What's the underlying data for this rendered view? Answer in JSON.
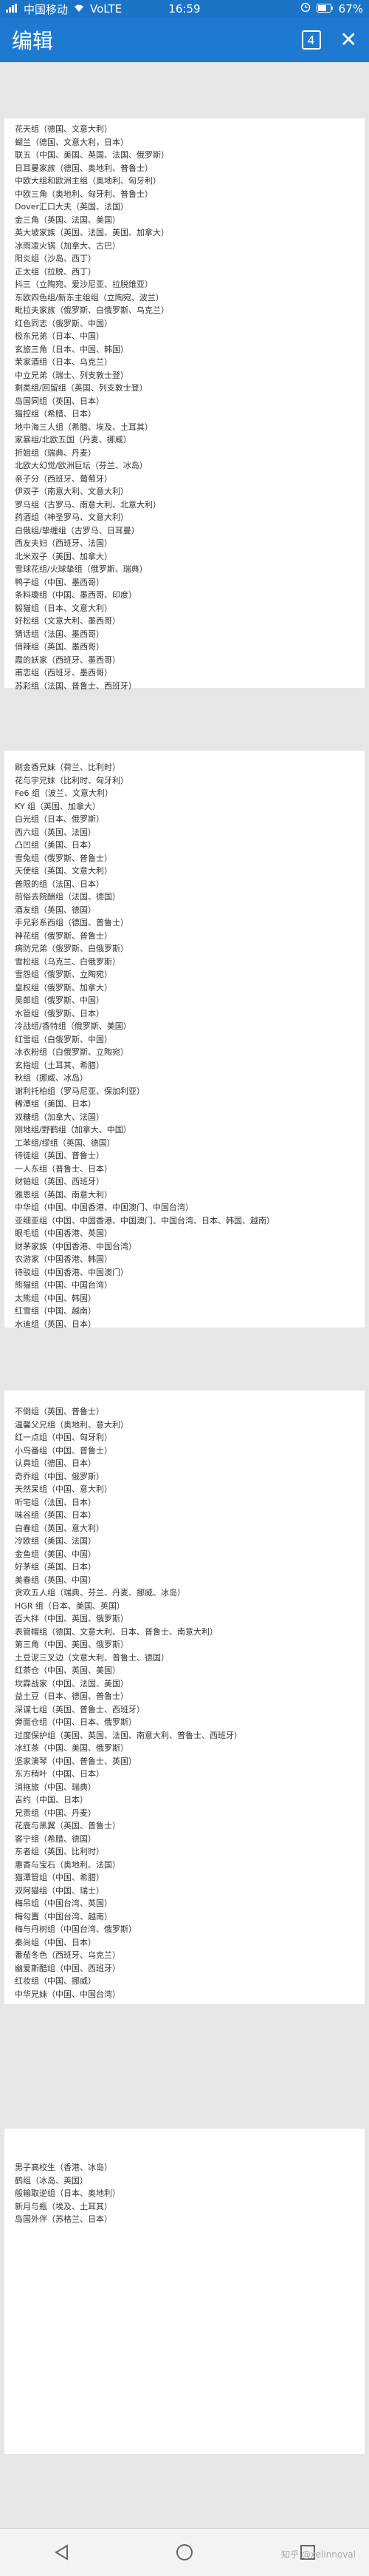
{
  "status_bar": {
    "carrier": "中国移动",
    "network": "VoLTE",
    "time": "16:59",
    "battery": "67%"
  },
  "toolbar": {
    "title": "编辑",
    "tab_count": "4"
  },
  "pages": [
    [
      "花天组（德国、文意大利）",
      "蝴兰（德国、文意大利，日本）",
      "联五（中国、美国、英国、法国、俄罗斯）",
      "日耳曼家族（德国、奥地利、普鲁士）",
      "中欧大组和欧洲主组（奥地利、匈牙利）",
      "中欧三角（奥地利、匈牙利、普鲁士）",
      "Dover汇口大夫（英国、法国）",
      "金三角（英国、法国、美国）",
      "英大坡家族（英国、法国、美国、加拿大）",
      "冰雨凌火锅（加拿大、古巴）",
      "阳炎组（沙岛、西丁）",
      "正太组（拉脱、西丁）",
      "抖三（立陶宛、爱沙尼亚、拉脱维亚）",
      "东欧四色组/新东主组组（立陶宛、波兰）",
      "毗拉夫家族（俄罗斯、白俄罗斯、乌克兰）",
      "红色同志（俄罗斯、中国）",
      "极东兄弟（日本、中国）",
      "玄旅三角（日本、中国、韩国）",
      "茉家酒组（日本、乌克兰）",
      "中立兄弟（瑞士、列支敦士登）",
      "剩类组/回留组（英国、列支敦士登）",
      "岛国同组（英国、日本）",
      "猫控组（希腊、日本）",
      "地中海三人组（希腊、埃及、土耳其）",
      "家暴组/北欧五国（丹麦、挪威）",
      "折姐组（瑞典、丹麦）",
      "北欧大幻觉/欧洲巨坛（芬兰、冰岛）",
      "亲子分（西班牙、葡萄牙）",
      "伊双子（南意大利、文意大利）",
      "罗马组（古罗马、南意大利、北意大利）",
      "药酒组（神圣罗马、文意大利）",
      "白俄组/挚缠组（古罗马、日耳曼）",
      "西友夫妇（西班牙、法国）",
      "北米双子（美国、加拿大）",
      "雪球花组/火球挚组（俄罗斯、瑞典）",
      "鸭子组（中国、墨西哥）",
      "条料瓊组（中国、墨西哥、印度）",
      "毅猫组（日本、文意大利）",
      "好松组（文意大利、墨西哥）",
      "猜话组（法国、墨西哥）",
      "俏辣组（英国、墨西哥）",
      "霞的妖家（西班牙、墨西哥）",
      "甫恋组（西班牙、墨西哥）",
      "苏彩组（法国、普鲁士、西班牙）"
    ],
    [
      "刷金香兄妹（荷兰、比利时）",
      "花与宇兄妹（比利时、匈牙利）",
      "Fe6 组（波兰、文意大利）",
      "KY 组（英国、加拿大）",
      "白光组（日本、俄罗斯）",
      "西六组（英国、法国）",
      "凸凹组（美国、日本）",
      "雪兔组（俄罗斯、普鲁士）",
      "天使组（英国、文意大利）",
      "普限的组（法国、日本）",
      "前俗去院酬组（法国、德国）",
      "酒友组（英国、德国）",
      "手兄彩系西组（德国、普鲁士）",
      "神花组（俄罗斯、普鲁士）",
      "病防兄弟（俄罗斯、白俄罗斯）",
      "雪松组（乌克兰、白俄罗斯）",
      "雪怨组（俄罗斯、立陶宛）",
      "皇权组（俄罗斯、加拿大）",
      "吴郎组（俄罗斯、中国）",
      "水管组（俄罗斯、日本）",
      "冷战组/香特组（俄罗斯、美国）",
      "红雪组（白俄罗斯、中国）",
      "冰衣粉组（白俄罗斯、立陶宛）",
      "玄指组（土耳其、希腊）",
      "秋组（挪威、冰岛）",
      "谢利托柏组（罗马尼亚、保加利亚）",
      "稀潭组（美国、日本）",
      "双糖组（加拿大、法国）",
      "刚地组/野鹤组（加拿大、中国）",
      "工苯组/缪组（英国、德国）",
      "待徒组（英国、普鲁士）",
      "一人东组（普鲁士、日本）",
      "财铂组（英国、西班牙）",
      "雅恩组（英国、南意大利）",
      "中华组（中国、中国香港、中国澳门、中国台湾）",
      "亚细亚组（中国、中国香港、中国澳门、中国台湾、日本、韩国、越南）",
      "眼毛组（中国香港、英国）",
      "财茅家族（中国香港、中国台湾）",
      "农游家（中国香港、韩国）",
      "待驳组（中国香港、中国澳门）",
      "熊猫组（中国、中国台湾）",
      "太熊组（中国、韩国）",
      "红雪组（中国、越南）",
      "水迪组（英国、日本）"
    ],
    [
      "不倒组（英国、普鲁士）",
      "温馨父兄组（奥地利、意大利）",
      "红一点组（中国、匈牙利）",
      "小鸟番组（中国、普鲁士）",
      "认真组（德国、日本）",
      "奇乔组（中国、俄罗斯）",
      "天然呆组（中国、意大利）",
      "听宅组（法国、日本）",
      "味谷组（英国、日本）",
      "白春组（英国、意大利）",
      "冷欧组（美国、法国）",
      "金鱼组（美国、中国）",
      "好茅组（英国、日本）",
      "美春组（英国、中国）",
      "贪欢五人组（瑞典、芬兰、丹麦、挪威、冰岛）",
      "HGR 组（日本、美国、英国）",
      "否大拌（中国、英国、俄罗斯）",
      "表管帽组（德国、文意大利、日本、普鲁士、南意大利）",
      "第三角（中国、美国、俄罗斯）",
      "土豆泥三叉边（文意大利、普鲁士、德国）",
      "红茶仓（中国、英国、美国）",
      "坎霖战家（中国、法国、美国）",
      "益土豆（日本、德国、普鲁士）",
      "深谋七组（英国、普鲁士、西班牙）",
      "旁面仓组（中国、日本、俄罗斯）",
      "过度保护组（美国、英国、法国、南意大利、普鲁士、西班牙）",
      "冰红茶（中国、美国、俄罗斯）",
      "坚家演琴（中国、普鲁士、英国）",
      "东方稍叶（中国、日本）",
      "消拖旅（中国、瑞典）",
      "吉约（中国、日本）",
      "兄责组（中国、丹麦）",
      "花鹿与黑翼（英国、普鲁士）",
      "客宁组（希腊、德国）",
      "东者组（英国、比利时）",
      "惠香与宝石（奥地利、法国）",
      "猫潭管组（中国、希腊）",
      "双阿猫组（中国、瑞士）",
      "梅吊组（中国台湾、英国）",
      "梅勾置（中国台湾、越南）",
      "梅与丹树组（中国台湾、俄罗斯）",
      "秦尚组（中国、日本）",
      "番茄冬色（西班牙、乌克兰）",
      "幽爱斯酷组（中国、西班牙）",
      "红妆组（中国、挪威）",
      "中华兄妹（中国、中国台湾）"
    ],
    [
      "男子高校生（香港、冰岛）",
      "鹤组（冰岛、英国）",
      "般输取逆组（日本、奥地利）",
      "新月与瓶（埃及、土耳其）",
      "岛国外伴（苏格兰、日本）"
    ]
  ],
  "watermark": "知乎 @xelinnoval"
}
